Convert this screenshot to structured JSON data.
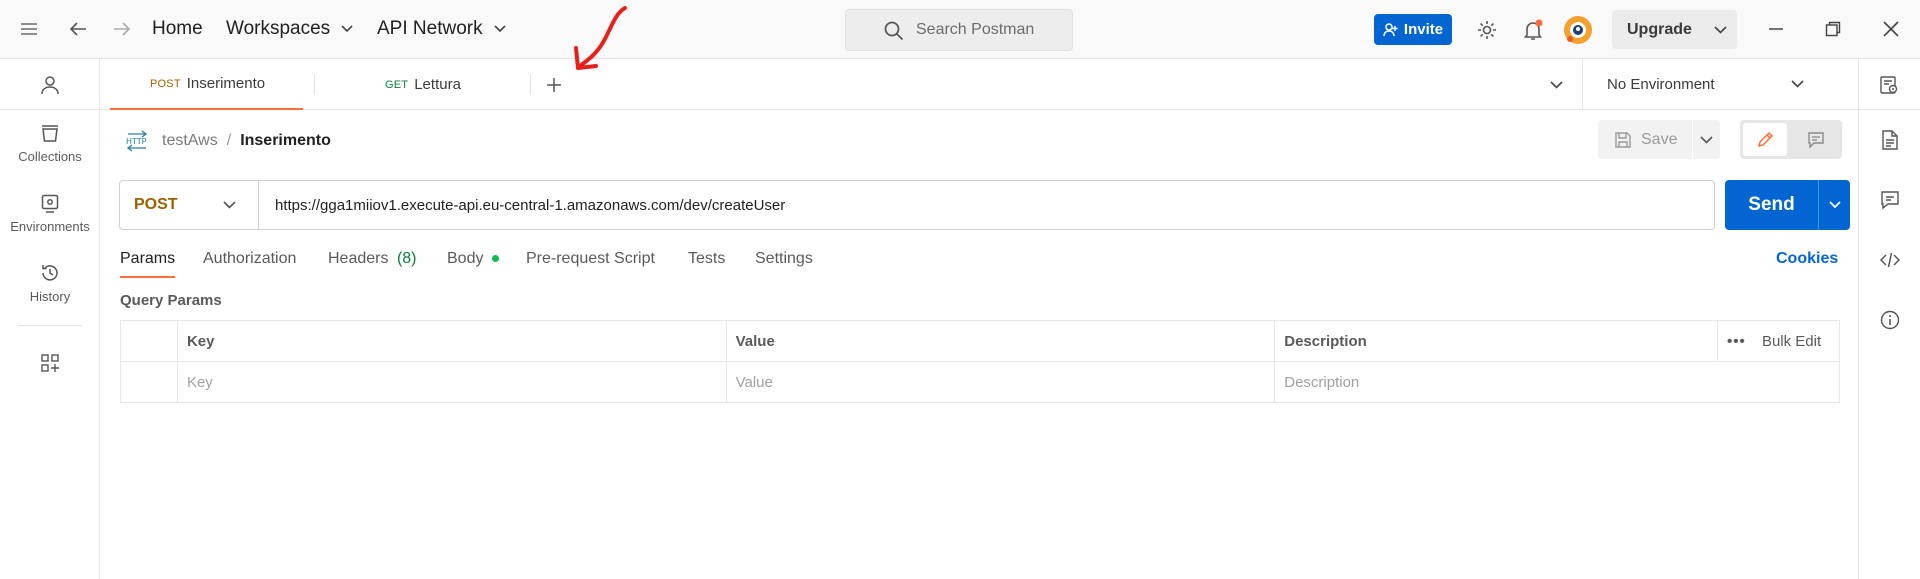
{
  "header": {
    "home": "Home",
    "workspaces": "Workspaces",
    "api_network": "API Network",
    "search_placeholder": "Search Postman",
    "invite": "Invite",
    "upgrade": "Upgrade"
  },
  "sidebar": {
    "items": [
      {
        "label": "Collections",
        "icon": "collections-icon"
      },
      {
        "label": "Environments",
        "icon": "environments-icon"
      },
      {
        "label": "History",
        "icon": "history-icon"
      }
    ]
  },
  "tabs": [
    {
      "method": "POST",
      "name": "Inserimento",
      "active": true
    },
    {
      "method": "GET",
      "name": "Lettura",
      "active": false
    }
  ],
  "environment": "No Environment",
  "breadcrumb": {
    "collection": "testAws",
    "separator": "/",
    "request": "Inserimento"
  },
  "save_label": "Save",
  "request": {
    "method": "POST",
    "url": "https://gga1miiov1.execute-api.eu-central-1.amazonaws.com/dev/createUser",
    "send_label": "Send"
  },
  "request_tabs": {
    "params": "Params",
    "authorization": "Authorization",
    "headers": "Headers",
    "headers_count": "(8)",
    "body": "Body",
    "prerequest": "Pre-request Script",
    "tests": "Tests",
    "settings": "Settings",
    "cookies": "Cookies"
  },
  "query_params": {
    "title": "Query Params",
    "columns": [
      "Key",
      "Value",
      "Description"
    ],
    "bulk_edit": "Bulk Edit",
    "placeholders": [
      "Key",
      "Value",
      "Description"
    ]
  },
  "colors": {
    "accent": "#0265d2",
    "active_tab_underline": "#ff6c37",
    "annotation": "#e8201a"
  }
}
